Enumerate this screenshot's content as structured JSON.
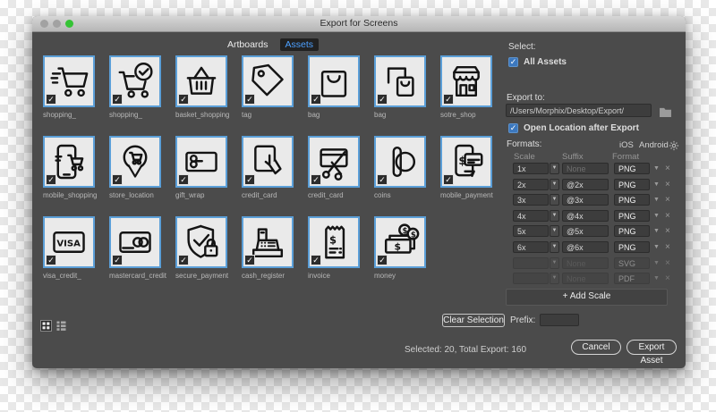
{
  "window": {
    "title": "Export for Screens"
  },
  "tabs": [
    {
      "label": "Artboards",
      "active": false
    },
    {
      "label": "Assets",
      "active": true
    }
  ],
  "assets": [
    {
      "label": "shopping_",
      "icon": "cart"
    },
    {
      "label": "shopping_",
      "icon": "cart-check"
    },
    {
      "label": "basket_shopping",
      "icon": "basket"
    },
    {
      "label": "tag",
      "icon": "tag"
    },
    {
      "label": "bag",
      "icon": "bag"
    },
    {
      "label": "bag",
      "icon": "bag-double"
    },
    {
      "label": "sotre_shop",
      "icon": "store"
    },
    {
      "label": "mobile_shopping",
      "icon": "phone-cart"
    },
    {
      "label": "store_location",
      "icon": "pin-cart"
    },
    {
      "label": "gift_wrap",
      "icon": "gift-card"
    },
    {
      "label": "credit_card",
      "icon": "card-hand"
    },
    {
      "label": "credit_card",
      "icon": "card-scissors"
    },
    {
      "label": "coins",
      "icon": "coins"
    },
    {
      "label": "mobile_payment",
      "icon": "phone-card"
    },
    {
      "label": "visa_credit_",
      "icon": "visa-card"
    },
    {
      "label": "mastercard_credit",
      "icon": "mastercard"
    },
    {
      "label": "secure_payment",
      "icon": "shield-lock"
    },
    {
      "label": "cash_register",
      "icon": "cash-register"
    },
    {
      "label": "invoice",
      "icon": "receipt"
    },
    {
      "label": "money",
      "icon": "money-bills"
    }
  ],
  "right_panel": {
    "select_label": "Select:",
    "all_assets": {
      "label": "All Assets",
      "checked": true
    },
    "export_to_label": "Export to:",
    "export_path": "/Users/Morphix/Desktop/Export/",
    "open_location": {
      "label": "Open Location after Export",
      "checked": true
    },
    "formats_label": "Formats:",
    "platform_links": [
      "iOS",
      "Android"
    ],
    "columns": [
      "Scale",
      "Suffix",
      "Format"
    ],
    "rows": [
      {
        "scale": "1x",
        "suffix": "",
        "placeholder": "None",
        "format": "PNG",
        "enabled": true
      },
      {
        "scale": "2x",
        "suffix": "@2x",
        "placeholder": "",
        "format": "PNG",
        "enabled": true
      },
      {
        "scale": "3x",
        "suffix": "@3x",
        "placeholder": "",
        "format": "PNG",
        "enabled": true
      },
      {
        "scale": "4x",
        "suffix": "@4x",
        "placeholder": "",
        "format": "PNG",
        "enabled": true
      },
      {
        "scale": "5x",
        "suffix": "@5x",
        "placeholder": "",
        "format": "PNG",
        "enabled": true
      },
      {
        "scale": "6x",
        "suffix": "@6x",
        "placeholder": "",
        "format": "PNG",
        "enabled": true
      },
      {
        "scale": "",
        "suffix": "",
        "placeholder": "None",
        "format": "SVG",
        "enabled": false
      },
      {
        "scale": "",
        "suffix": "",
        "placeholder": "None",
        "format": "PDF",
        "enabled": false
      }
    ],
    "add_scale_label": "+ Add Scale"
  },
  "footer": {
    "clear_selection_label": "Clear Selection",
    "prefix_label": "Prefix:",
    "prefix_value": "",
    "status": "Selected: 20, Total Export: 160",
    "cancel_label": "Cancel",
    "export_label": "Export Asset"
  },
  "colors": {
    "tile_border": "#5b9fd8",
    "checkbox_blue": "#3c78be",
    "tab_active_text": "#4da0ff",
    "window_bg": "#4b4b4b"
  }
}
